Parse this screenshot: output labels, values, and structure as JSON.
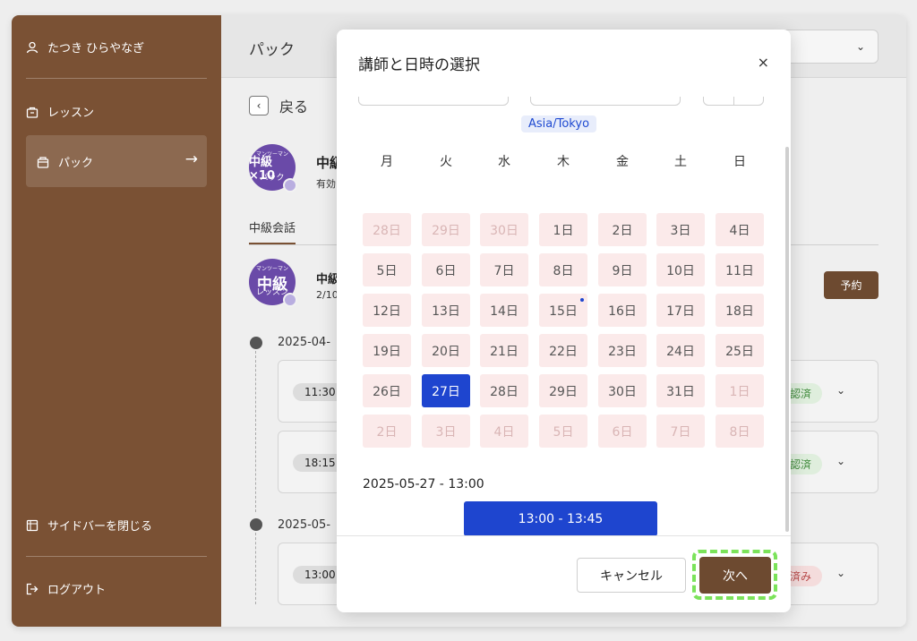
{
  "sidebar": {
    "user_name": "たつき ひらやなぎ",
    "items": [
      {
        "label": "レッスン"
      },
      {
        "label": "パック",
        "arrow": "→"
      }
    ],
    "close_sidebar": "サイドバーを閉じる",
    "logout": "ログアウト"
  },
  "main": {
    "title": "パック",
    "back": "戻る",
    "pack": {
      "badge_top": "マンツーマン",
      "badge_main": "中級×10",
      "badge_sub": "パック",
      "name": "中級",
      "sub": "有効"
    },
    "tab": "中級会話",
    "lesson": {
      "badge_top": "マンツーマン",
      "badge_main": "中級",
      "badge_sub": "レッスン",
      "name": "中級",
      "sub": "2/10"
    },
    "reserve_label": "予約",
    "timeline": [
      {
        "date": "2025-04-",
        "cards": [
          {
            "time": "11:30",
            "status": "認済",
            "status_kind": "g"
          },
          {
            "time": "18:15",
            "status": "認済",
            "status_kind": "g"
          }
        ]
      },
      {
        "date": "2025-05-",
        "cards": [
          {
            "time": "13:00",
            "status": "済み",
            "status_kind": "r"
          }
        ]
      }
    ]
  },
  "modal": {
    "title": "講師と日時の選択",
    "close": "×",
    "timezone": "Asia/Tokyo",
    "weekdays": [
      "月",
      "火",
      "水",
      "木",
      "金",
      "土",
      "日"
    ],
    "weeks": [
      [
        "28日",
        "29日",
        "30日",
        "1日",
        "2日",
        "3日",
        "4日"
      ],
      [
        "5日",
        "6日",
        "7日",
        "8日",
        "9日",
        "10日",
        "11日"
      ],
      [
        "12日",
        "13日",
        "14日",
        "15日",
        "16日",
        "17日",
        "18日"
      ],
      [
        "19日",
        "20日",
        "21日",
        "22日",
        "23日",
        "24日",
        "25日"
      ],
      [
        "26日",
        "27日",
        "28日",
        "29日",
        "30日",
        "31日",
        "1日"
      ],
      [
        "2日",
        "3日",
        "4日",
        "5日",
        "6日",
        "7日",
        "8日"
      ]
    ],
    "selected_day": "27日",
    "selected_datetime": "2025-05-27 - 13:00",
    "slot": "13:00 - 13:45",
    "cancel": "キャンセル",
    "next": "次へ"
  },
  "colors": {
    "brand": "#7a5134",
    "accent": "#1e45cf",
    "day_bg": "#fbeaea",
    "highlight": "#7be35a"
  }
}
